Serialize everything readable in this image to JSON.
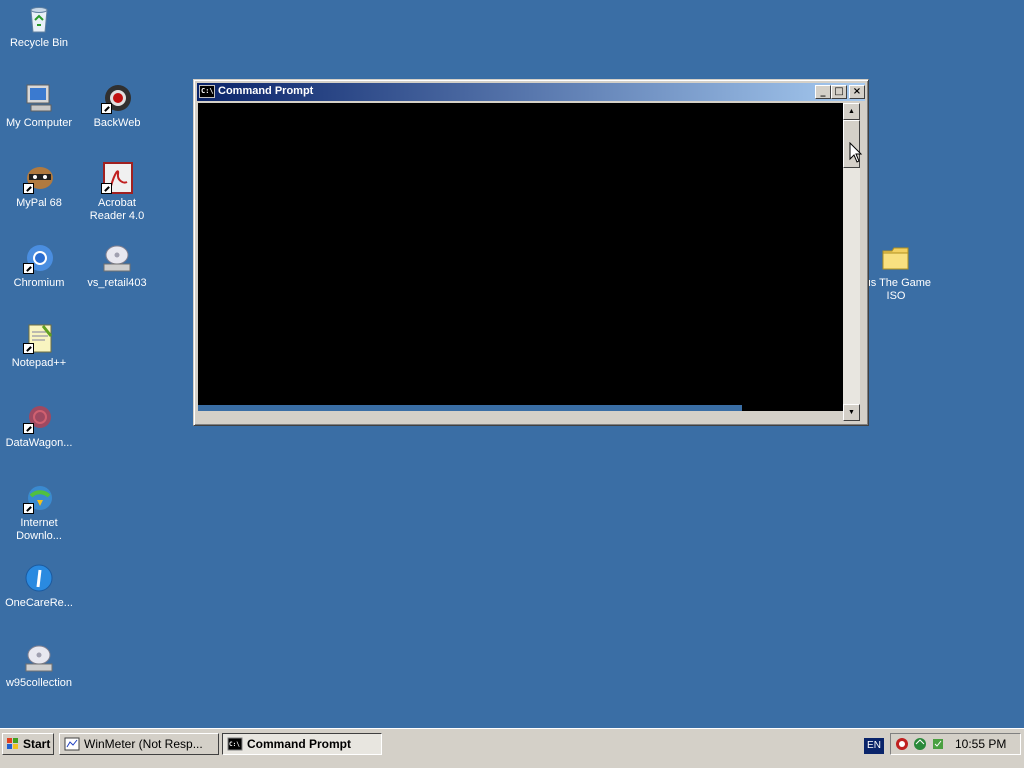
{
  "desktop": {
    "icons": [
      {
        "label": "Recycle Bin",
        "icon": "recycle-bin-icon"
      },
      {
        "label": "My Computer",
        "icon": "my-computer-icon"
      },
      {
        "label": "BackWeb",
        "icon": "backweb-icon"
      },
      {
        "label": "MyPal 68",
        "icon": "mypal-icon"
      },
      {
        "label": "Acrobat\nReader 4.0",
        "icon": "acrobat-reader-icon"
      },
      {
        "label": "Chromium",
        "icon": "chromium-icon"
      },
      {
        "label": "vs_retail403",
        "icon": "cd-drive-icon"
      },
      {
        "label": "Notepad++",
        "icon": "notepad-plus-plus-icon"
      },
      {
        "label": "DataWagon...",
        "icon": "datawagon-icon"
      },
      {
        "label": "Internet\nDownlo...",
        "icon": "internet-download-manager-icon"
      },
      {
        "label": "OneCareRe...",
        "icon": "onecare-icon"
      },
      {
        "label": "w95collection",
        "icon": "cd-drive-icon"
      },
      {
        "label": "rus The Game\nISO",
        "icon": "folder-icon"
      }
    ]
  },
  "window": {
    "title": "Command Prompt",
    "icon_text": "C:\\",
    "minimize_glyph": "_",
    "maximize_glyph": "□",
    "close_glyph": "×"
  },
  "taskbar": {
    "start_label": "Start",
    "items": [
      {
        "label": "WinMeter (Not Resp...",
        "active": false
      },
      {
        "label": "Command Prompt",
        "active": true
      }
    ],
    "language": "EN",
    "clock": "10:55 PM"
  }
}
